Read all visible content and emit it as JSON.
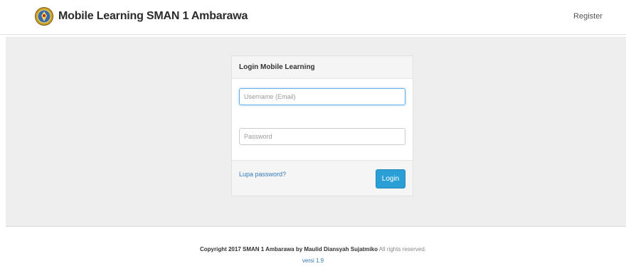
{
  "navbar": {
    "logo_icon": "school-emblem-icon",
    "brand_title": "Mobile Learning SMAN 1 Ambarawa",
    "register_label": "Register"
  },
  "login": {
    "heading": "Login Mobile Learning",
    "username_placeholder": "Username (Email)",
    "password_placeholder": "Password",
    "forgot_label": "Lupa password?",
    "login_label": "Login"
  },
  "footer": {
    "copyright": "Copyright 2017 SMAN 1 Ambarawa by Maulid Diansyah Sujatmiko",
    "rights": " All rights reserved.",
    "version": "versi 1.9"
  },
  "colors": {
    "primary_button": "#2a9fd6",
    "link": "#337ab7",
    "hero_background": "#eeeeee"
  }
}
